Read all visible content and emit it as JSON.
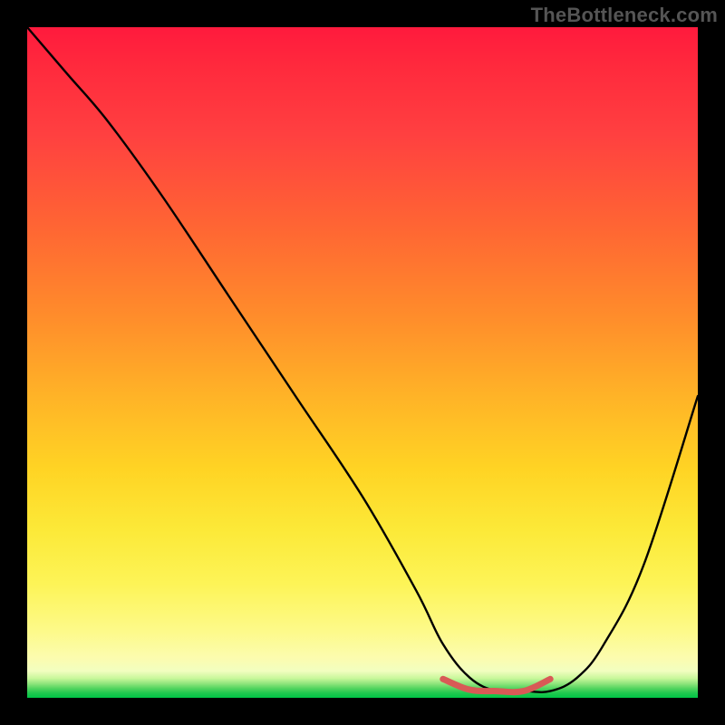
{
  "attribution": "TheBottleneck.com",
  "colors": {
    "frame_bg": "#000000",
    "curve_stroke": "#000000",
    "accent_stroke": "#d85a56",
    "gradient_top": "#ff1a3d",
    "gradient_mid": "#ffd424",
    "gradient_bottom": "#00c546",
    "attribution_text": "#555555"
  },
  "chart_data": {
    "type": "line",
    "title": "",
    "xlabel": "",
    "ylabel": "",
    "xlim": [
      0,
      100
    ],
    "ylim": [
      0,
      100
    ],
    "series": [
      {
        "name": "main-curve",
        "x": [
          0,
          6,
          12,
          20,
          30,
          40,
          50,
          58,
          62,
          66,
          70,
          74,
          78,
          82,
          86,
          92,
          100
        ],
        "y": [
          100,
          93,
          86,
          75,
          60,
          45,
          30,
          16,
          8,
          3,
          1,
          1,
          1,
          3,
          8,
          20,
          45
        ]
      },
      {
        "name": "accent-segment",
        "x": [
          62,
          66,
          70,
          74,
          78
        ],
        "y": [
          2.8,
          1.2,
          1.0,
          1.0,
          2.8
        ]
      }
    ],
    "notes": "y is plotted with origin at bottom of the gradient; values estimated from pixels."
  }
}
